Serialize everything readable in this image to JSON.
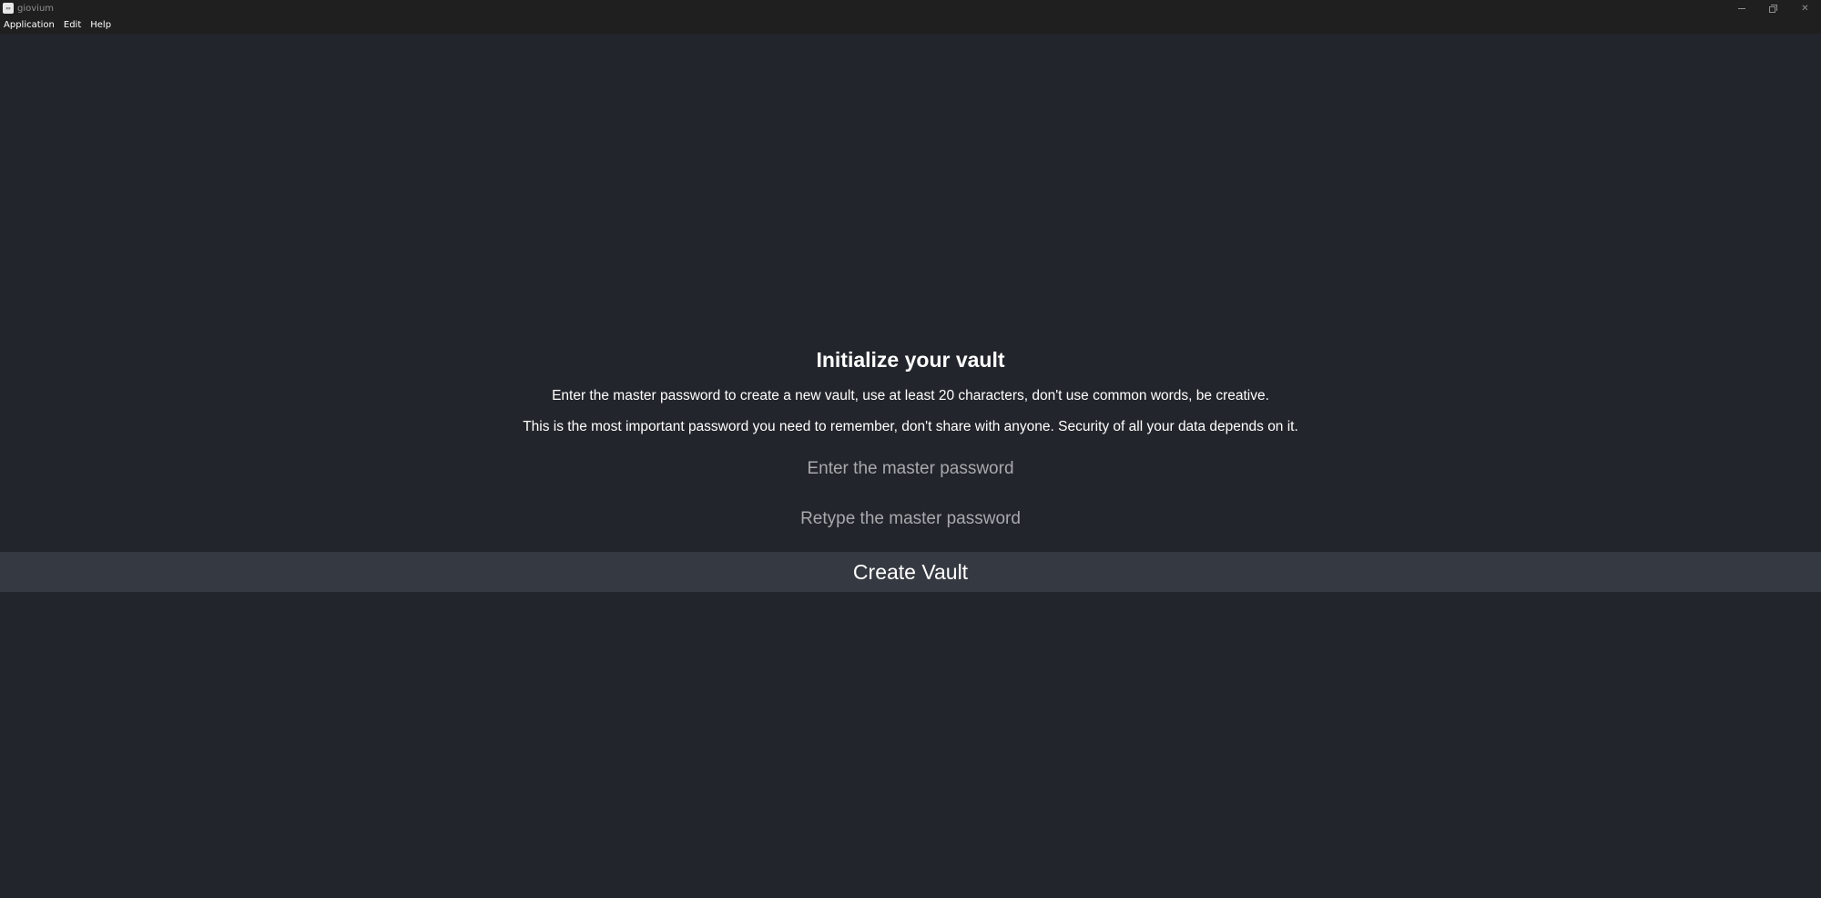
{
  "window": {
    "title": "giovium",
    "icon": "app-icon",
    "controls": {
      "minimize": "minimize-icon",
      "restore": "restore-icon",
      "close_glyph": "✕"
    }
  },
  "menubar": {
    "items": [
      {
        "label": "Application"
      },
      {
        "label": "Edit"
      },
      {
        "label": "Help"
      }
    ]
  },
  "vault_init": {
    "heading": "Initialize your vault",
    "description_1": "Enter the master password to create a new vault, use at least 20 characters, don't use common words, be creative.",
    "description_2": "This is the most important password you need to remember, don't share with anyone. Security of all your data depends on it.",
    "password_placeholder": "Enter the master password",
    "password_value": "",
    "retype_placeholder": "Retype the master password",
    "retype_value": "",
    "create_button": "Create Vault"
  },
  "colors": {
    "background": "#22252b",
    "titlebar": "#1f1f1f",
    "button": "#353941",
    "text": "#ffffff",
    "placeholder": "#a7a9ad"
  }
}
